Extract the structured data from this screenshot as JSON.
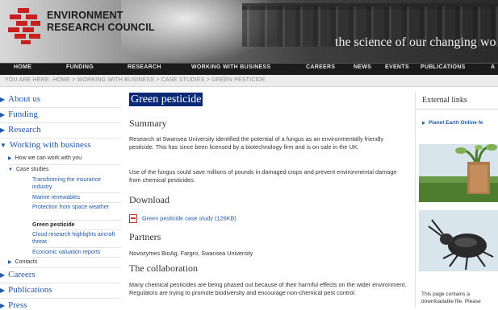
{
  "header": {
    "org_line1": "ENVIRONMENT",
    "org_line2": "RESEARCH COUNCIL",
    "tagline": "the science of our changing wo"
  },
  "nav": [
    "HOME",
    "FUNDING",
    "RESEARCH",
    "WORKING WITH BUSINESS",
    "CAREERS",
    "NEWS",
    "EVENTS",
    "PUBLICATIONS",
    "A"
  ],
  "breadcrumb": "YOU ARE HERE: HOME > WORKING WITH BUSINESS > CASE STUDIES > GREEN PESTICIDE",
  "sidebar": {
    "about": "About us",
    "funding": "Funding",
    "research": "Research",
    "working": "Working with business",
    "how": "How we can work with you",
    "case": "Case studies",
    "transforming": "Transforming the insurance industry",
    "marine": "Marine renewables",
    "protection": "Protection from space weather",
    "green": "Green pesticide",
    "cloud": "Cloud research highlights aircraft threat",
    "economic": "Economic valuation reports",
    "contacts": "Contacts",
    "careers": "Careers",
    "publications": "Publications",
    "press": "Press"
  },
  "main": {
    "title": "Green pesticide",
    "summary_heading": "Summary",
    "summary_p1": "Research at Swansea University identified the potential of a fungus as an environmentally friendly pesticide. This has since been licensed by a biotechnology firm and is on sale in the UK.",
    "summary_p2": "Use of the fungus could save millions of pounds in damaged crops and prevent environmental damage from chemical pesticides.",
    "download_heading": "Download",
    "download_link": "Green pesticide case study (126KB)",
    "partners_heading": "Partners",
    "partners_text": "Novozymes BioAg, Fargro, Swansea University",
    "collab_heading": "The collaboration",
    "collab_text": "Many chemical pesticides are being phased out because of their harmful effects on the wider environment. Regulators are trying to promote biodiversity and encourage non-chemical pest control."
  },
  "right": {
    "external_heading": "External links",
    "planet_link": "Planet Earth Online fe",
    "note": "This page contains a downloadable file. Please"
  },
  "colors": {
    "link": "#1f5aa8",
    "title_bg": "#0a2a78",
    "logo_red": "#c8201e"
  },
  "icons": [
    "erc-logo",
    "arrow-right-icon",
    "arrow-down-icon",
    "pdf-icon"
  ]
}
